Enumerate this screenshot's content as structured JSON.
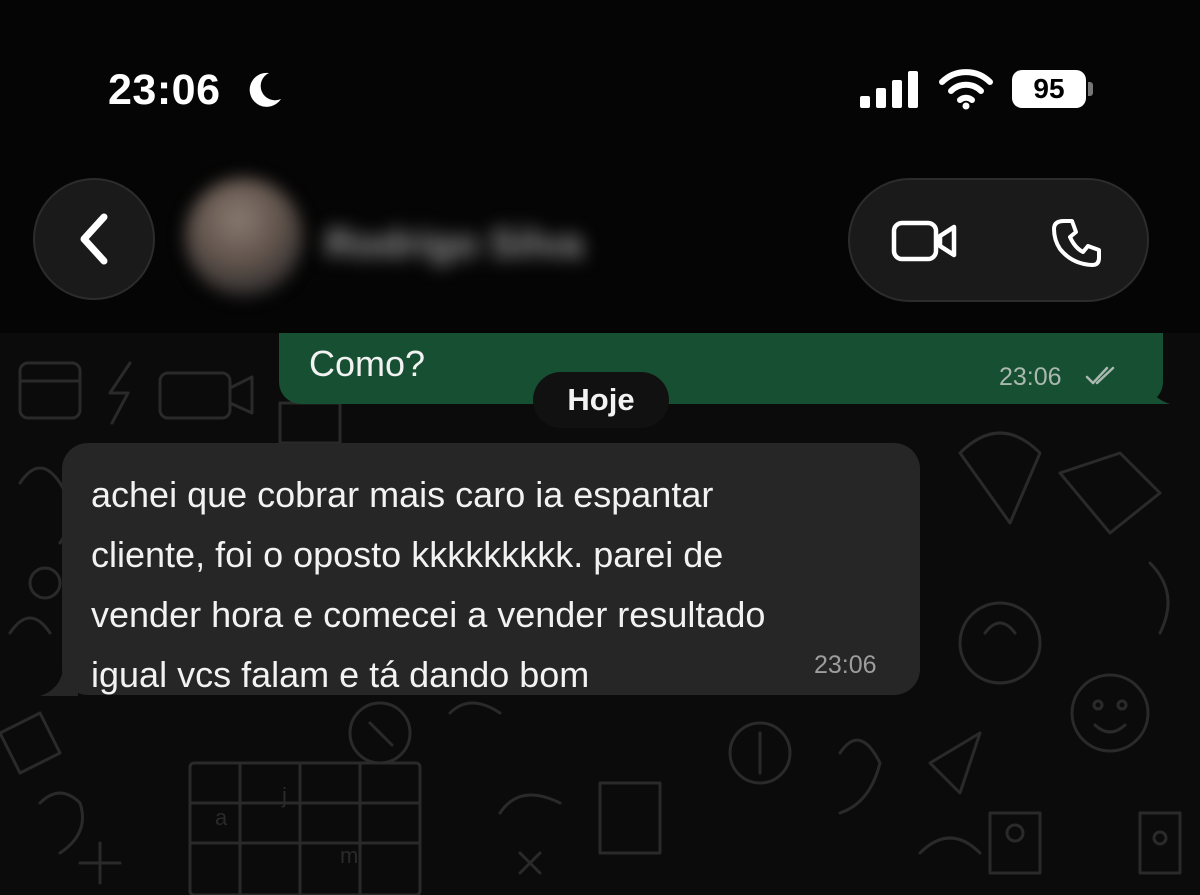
{
  "status_bar": {
    "time": "23:06",
    "battery": "95",
    "icons": [
      "moon-icon",
      "signal-icon",
      "wifi-icon"
    ]
  },
  "header": {
    "contact_name": "Rodrigo Silva",
    "icons": [
      "chevron-left-icon",
      "video-camera-icon",
      "phone-icon"
    ]
  },
  "chat": {
    "outgoing": {
      "text": "Como?",
      "time": "23:06"
    },
    "date_separator": "Hoje",
    "incoming": {
      "lines": [
        "achei que cobrar mais caro ia espantar",
        "cliente, foi o oposto kkkkkkkkk. parei de",
        "vender hora e comecei a vender resultado",
        "igual vcs falam e tá dando bom"
      ],
      "time": "23:06"
    }
  },
  "colors": {
    "outgoing_bubble": "#164f32",
    "incoming_bubble": "#262626",
    "background": "#050505"
  }
}
